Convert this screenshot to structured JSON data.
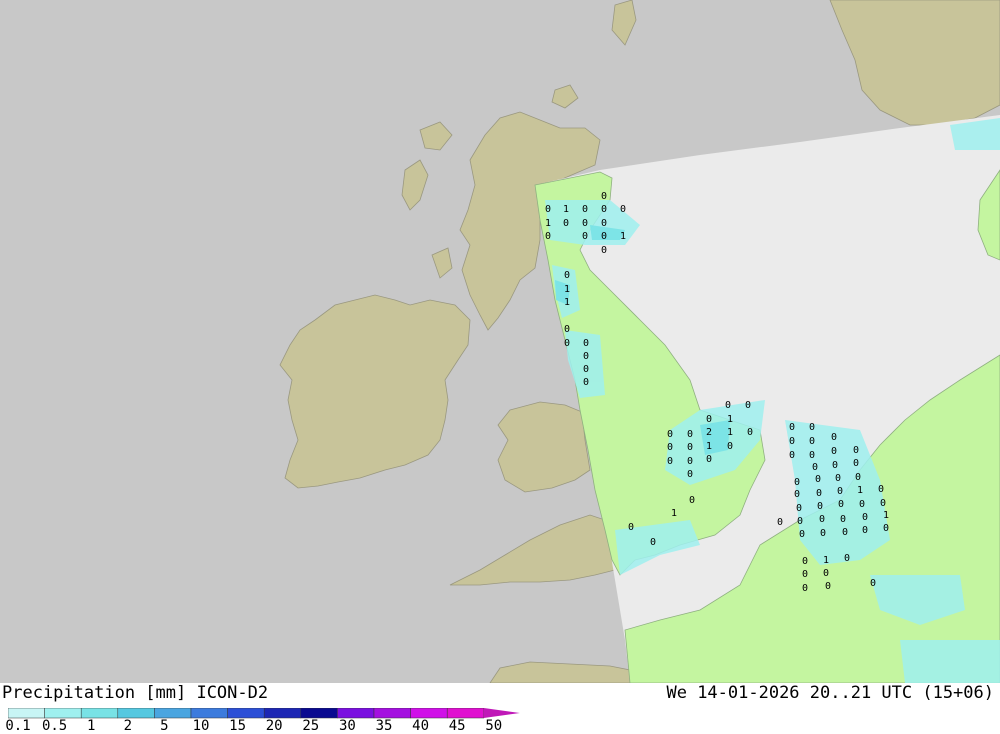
{
  "title": {
    "left": "Precipitation [mm] ICON-D2",
    "right": "We 14-01-2026 20..21 UTC (15+06)"
  },
  "legend": {
    "ticks": [
      "0.1",
      "0.5",
      "1",
      "2",
      "5",
      "10",
      "15",
      "20",
      "25",
      "30",
      "35",
      "40",
      "45",
      "50"
    ],
    "colors": [
      "#c8f5f5",
      "#9ff0ef",
      "#78e2e5",
      "#55c8e0",
      "#4aa5e0",
      "#3c7bdd",
      "#2c4fd6",
      "#1d27b4",
      "#0a0a90",
      "#7a10e0",
      "#a410e0",
      "#d010e8",
      "#e010d0",
      "#c018b8"
    ]
  },
  "map_colors": {
    "sea_outside": "#c8c8c8",
    "land_outside": "#c8c49a",
    "sea_inside": "#ebebeb",
    "land_inside": "#c4f5a0"
  },
  "precip_values": [
    "0",
    "1",
    "0",
    "0",
    "0",
    "1",
    "0",
    "0",
    "0",
    "0",
    "0",
    "0",
    "0",
    "1",
    "0",
    "0",
    "1",
    "1",
    "0",
    "0",
    "0",
    "0",
    "0",
    "0",
    "0",
    "0",
    "0",
    "1",
    "0",
    "0",
    "2",
    "1",
    "0",
    "0",
    "0",
    "1",
    "0",
    "0",
    "0",
    "0",
    "0",
    "0",
    "0",
    "0",
    "0",
    "0",
    "0",
    "0",
    "0",
    "0",
    "0",
    "0",
    "0",
    "0",
    "0",
    "0",
    "0",
    "0",
    "0",
    "0",
    "0",
    "1",
    "0",
    "0",
    "0",
    "0",
    "0",
    "0",
    "0",
    "0",
    "0",
    "0",
    "0",
    "1",
    "0",
    "0",
    "0",
    "0",
    "0",
    "0",
    "1",
    "0",
    "0",
    "0",
    "0",
    "0",
    "0",
    "1",
    "0",
    "0",
    "1",
    "1"
  ]
}
